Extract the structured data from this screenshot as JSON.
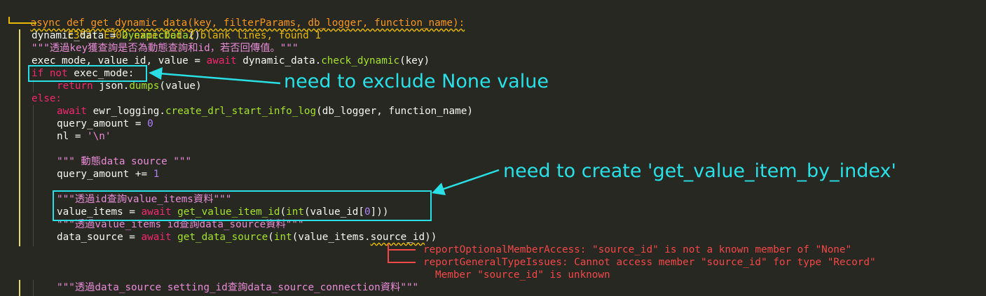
{
  "code": {
    "def_line": "async def get_dynamic_data(key, filterParams, db_logger, function_name):",
    "diag_e302": "E302: E302 expected 2 blank lines, found 1",
    "l_dynamic_data": "dynamic_data",
    "l_eq": " = ",
    "l_DynamicData": "DynamicData",
    "l_parens": "()",
    "l_doc1": "\"\"\"透過key獲查詢是否為動態查詢和id，若否回傳值。\"\"\"",
    "l_exec_mode": "exec_mode, value_id, value = ",
    "l_await": "await",
    "l_dd_check": " dynamic_data.",
    "l_check_dynamic": "check_dynamic",
    "l_key_arg": "(key)",
    "l_if": "if",
    "l_not": " not ",
    "l_exec_mode_cond": "exec_mode:",
    "l_return": "return",
    "l_json": " json.",
    "l_dumps": "dumps",
    "l_value_arg": "(value)",
    "l_else": "else:",
    "l_ewr": " ewr_logging.",
    "l_create_log": "create_drl_start_info_log",
    "l_log_args": "(db_logger, function_name)",
    "l_query_amount": "query_amount",
    "l_zero": "0",
    "l_nl": "nl",
    "l_nl_str": "'\\n'",
    "l_doc2": "\"\"\" 動態data source \"\"\"",
    "l_plus_eq": " += ",
    "l_one": "1",
    "l_doc3": "\"\"\"透過id查詢value_items資料\"\"\"",
    "l_value_items": "value_items",
    "l_get_value_item_id": "get_value_item_id",
    "l_int": "int",
    "l_vid_args": "(value_id[",
    "l_close3": "]))",
    "l_doc4": "\"\"\"透過value_items id查詢data_source資料\"\"\"",
    "l_data_source": "data_source",
    "l_get_data_source": "get_data_source",
    "l_vi_args": "(value_items.",
    "l_source_id": "source_id",
    "l_close2": "))",
    "diag_r1": "reportOptionalMemberAccess: \"source_id\" is not a known member of \"None\"",
    "diag_r2": "reportGeneralTypeIssues: Cannot access member \"source_id\" for type \"Record\"",
    "diag_r3": "Member \"source_id\" is unknown",
    "l_doc5": "\"\"\"透過data_source setting_id查詢data_source_connection資料\"\"\""
  },
  "annotations": {
    "note1": "need to exclude None value",
    "note2": "need to create 'get_value_item_by_index'"
  },
  "colors": {
    "background": "#272822",
    "keyword": "#f92672",
    "function": "#a6e22e",
    "string": "#e6db74",
    "number": "#ae81ff",
    "annotation": "#29e0e6",
    "warning": "#e6b800",
    "error": "#f44747"
  }
}
